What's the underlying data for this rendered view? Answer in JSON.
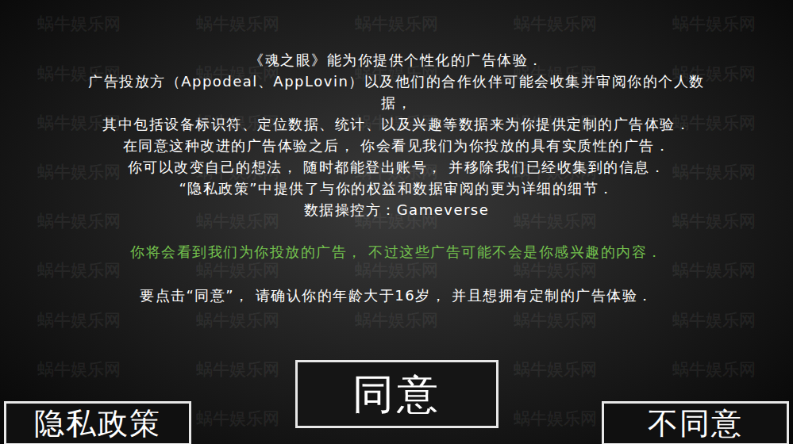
{
  "watermark": "蜗牛娱乐网",
  "notice": {
    "lines": [
      "《魂之眼》能为你提供个性化的广告体验．",
      "广告投放方（Appodeal、AppLovin）以及他们的合作伙伴可能会收集并审阅你的个人数",
      "据，",
      "其中包括设备标识符、定位数据、统计、以及兴趣等数据来为你提供定制的广告体验．",
      "在同意这种改进的广告体验之后， 你会看见我们为你投放的具有实质性的广告．",
      "你可以改变自己的想法， 随时都能登出账号， 并移除我们已经收集到的信息．",
      "“隐私政策”中提供了与你的权益和数据审阅的更为详细的细节．",
      "数据操控方：Gameverse"
    ],
    "highlight": "你将会看到我们为你投放的广告， 不过这些广告可能不会是你感兴趣的内容．",
    "age_note": "要点击“同意”， 请确认你的年龄大于16岁， 并且想拥有定制的广告体验．"
  },
  "privacy_button": "隐私政策",
  "agree_button": "同意",
  "disagree_button": "不同意"
}
